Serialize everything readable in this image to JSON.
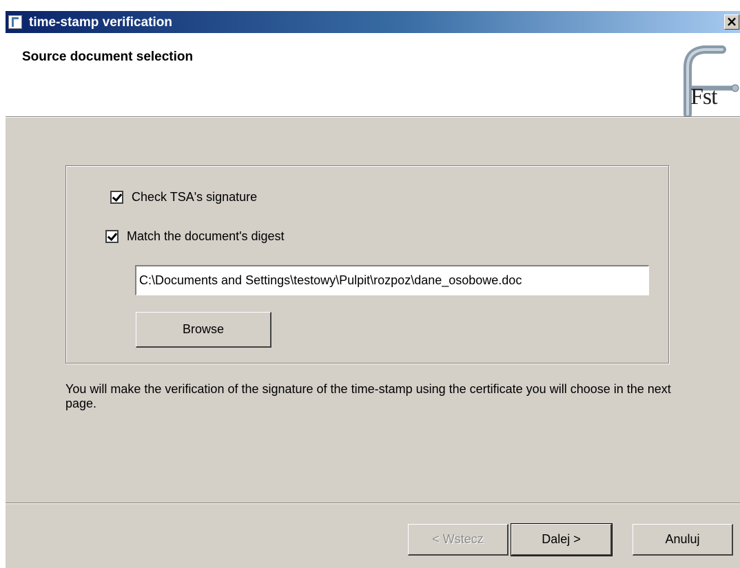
{
  "window": {
    "title": "time-stamp verification",
    "close_glyph": "×",
    "icon": "app-icon"
  },
  "header": {
    "title": "Source document selection",
    "logo_text": "Fst",
    "logo_icon": "fst-logo"
  },
  "options": {
    "check_tsa": {
      "label": "Check TSA's signature",
      "checked": true
    },
    "match_digest": {
      "label": "Match the document's digest",
      "checked": true
    }
  },
  "file": {
    "path": "C:\\Documents and Settings\\testowy\\Pulpit\\rozpoz\\dane_osobowe.doc",
    "browse_label": "Browse"
  },
  "info_text": "You will make the verification of the signature of the time-stamp using the certificate you will choose in the next page.",
  "footer": {
    "back_label": "< Wstecz",
    "next_label": "Dalej >",
    "cancel_label": "Anuluj"
  },
  "colors": {
    "titlebar_start": "#0a246a",
    "titlebar_end": "#a6caf0",
    "dialog_bg": "#d4d0c8"
  }
}
